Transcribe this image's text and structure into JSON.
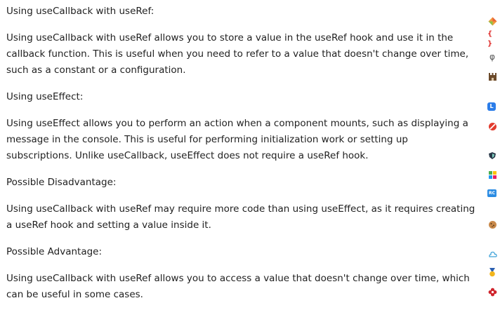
{
  "sections": [
    {
      "heading": "Using useCallback with useRef:",
      "text": "Using useCallback with useRef allows you to store a value in the useRef hook and use it in the\ncallback function. This is useful when you need to refer to a value that doesn't change over time,\nsuch as a constant or a configuration."
    },
    {
      "heading": "Using useEffect:",
      "text": "Using useEffect allows you to perform an action when a component mounts, such as displaying a\nmessage in the console. This is useful for performing initialization work or setting up\nsubscriptions. Unlike useCallback, useEffect does not require a useRef hook."
    },
    {
      "heading": "Possible Disadvantage:",
      "text": "Using useCallback with useRef may require more code than using useEffect, as it requires creating\na useRef hook and setting a value inside it."
    },
    {
      "heading": "Possible Advantage:",
      "text": "Using useCallback with useRef allows you to access a value that doesn't change over time, which\ncan be useful in some cases."
    }
  ],
  "rail_icons": [
    {
      "name": "extension-diamond-icon",
      "color": "#e8623a"
    },
    {
      "name": "braces-icon",
      "glyph": "{ }",
      "color": "#e0312f"
    },
    {
      "name": "phi-icon",
      "glyph": "φ",
      "color": "#555555"
    },
    {
      "name": "castle-icon",
      "color": "#6b4a2b"
    },
    {
      "name": "l-badge-icon",
      "glyph": "L",
      "color": "#2b7de9"
    },
    {
      "name": "no-entry-icon",
      "color": "#e23b2e"
    },
    {
      "name": "shield-icon",
      "color": "#2a3a4a"
    },
    {
      "name": "colorful-grid-icon",
      "color": "#4caf50"
    },
    {
      "name": "rc-badge-icon",
      "glyph": "RC",
      "color": "#2b8ce3"
    },
    {
      "name": "cookie-icon",
      "color": "#c98a4b"
    },
    {
      "name": "cloud-outline-icon",
      "color": "#3aa0d8"
    },
    {
      "name": "medal-icon",
      "color": "#f2b51c"
    },
    {
      "name": "flower-icon",
      "color": "#d0262e"
    }
  ]
}
